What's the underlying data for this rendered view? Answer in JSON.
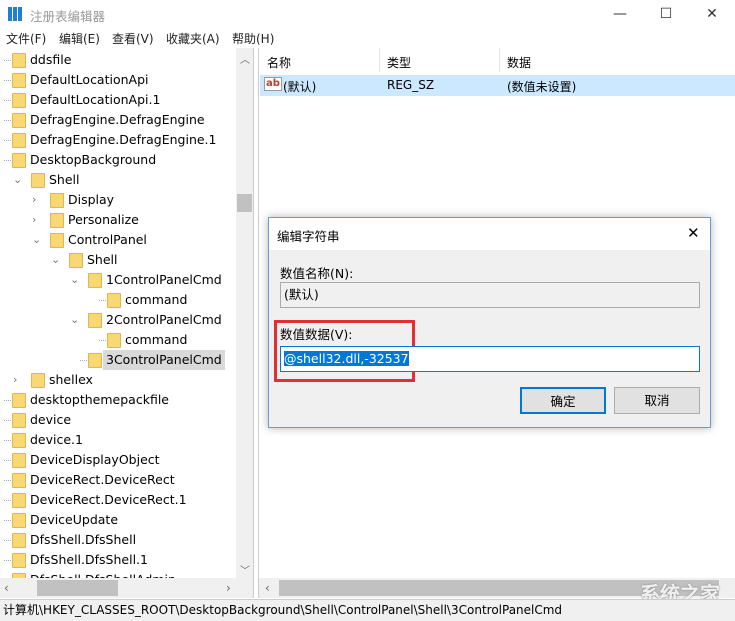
{
  "window": {
    "title": "注册表编辑器",
    "minimize": "—",
    "maximize": "☐",
    "close": "✕"
  },
  "menu": [
    "文件(F)",
    "编辑(E)",
    "查看(V)",
    "收藏夹(A)",
    "帮助(H)"
  ],
  "tree": [
    {
      "label": "ddsfile",
      "level": 0,
      "expander": ""
    },
    {
      "label": "DefaultLocationApi",
      "level": 0,
      "expander": ""
    },
    {
      "label": "DefaultLocationApi.1",
      "level": 0,
      "expander": ""
    },
    {
      "label": "DefragEngine.DefragEngine",
      "level": 0,
      "expander": ""
    },
    {
      "label": "DefragEngine.DefragEngine.1",
      "level": 0,
      "expander": ""
    },
    {
      "label": "DesktopBackground",
      "level": 0,
      "expander": ""
    },
    {
      "label": "Shell",
      "level": 1,
      "expander": "expanded"
    },
    {
      "label": "Display",
      "level": 2,
      "expander": "collapsed"
    },
    {
      "label": "Personalize",
      "level": 2,
      "expander": "collapsed"
    },
    {
      "label": "ControlPanel",
      "level": 2,
      "expander": "expanded"
    },
    {
      "label": "Shell",
      "level": 3,
      "expander": "expanded"
    },
    {
      "label": "1ControlPanelCmd",
      "level": 4,
      "expander": "expanded"
    },
    {
      "label": "command",
      "level": 5,
      "expander": ""
    },
    {
      "label": "2ControlPanelCmd",
      "level": 4,
      "expander": "expanded"
    },
    {
      "label": "command",
      "level": 5,
      "expander": ""
    },
    {
      "label": "3ControlPanelCmd",
      "level": 4,
      "expander": "",
      "selected": true
    },
    {
      "label": "shellex",
      "level": 1,
      "expander": "collapsed"
    },
    {
      "label": "desktopthemepackfile",
      "level": 0,
      "expander": ""
    },
    {
      "label": "device",
      "level": 0,
      "expander": ""
    },
    {
      "label": "device.1",
      "level": 0,
      "expander": ""
    },
    {
      "label": "DeviceDisplayObject",
      "level": 0,
      "expander": ""
    },
    {
      "label": "DeviceRect.DeviceRect",
      "level": 0,
      "expander": ""
    },
    {
      "label": "DeviceRect.DeviceRect.1",
      "level": 0,
      "expander": ""
    },
    {
      "label": "DeviceUpdate",
      "level": 0,
      "expander": ""
    },
    {
      "label": "DfsShell.DfsShell",
      "level": 0,
      "expander": ""
    },
    {
      "label": "DfsShell.DfsShell.1",
      "level": 0,
      "expander": ""
    },
    {
      "label": "DfsShell.DfsShellAdmin",
      "level": 0,
      "expander": ""
    }
  ],
  "values": {
    "headers": {
      "name": "名称",
      "type": "类型",
      "data": "数据"
    },
    "rows": [
      {
        "icon": "ab",
        "name": "(默认)",
        "type": "REG_SZ",
        "data": "(数值未设置)"
      }
    ]
  },
  "dialog": {
    "title": "编辑字符串",
    "close": "✕",
    "name_label": "数值名称(N):",
    "name_value": "(默认)",
    "data_label": "数值数据(V):",
    "data_value": "@shell32.dll,-32537",
    "ok": "确定",
    "cancel": "取消"
  },
  "status": "计算机\\HKEY_CLASSES_ROOT\\DesktopBackground\\Shell\\ControlPanel\\Shell\\3ControlPanelCmd",
  "watermark": "系统之家",
  "colors": {
    "selection": "#cce8ff",
    "highlight": "#0078d7",
    "annotation": "#e03030"
  }
}
